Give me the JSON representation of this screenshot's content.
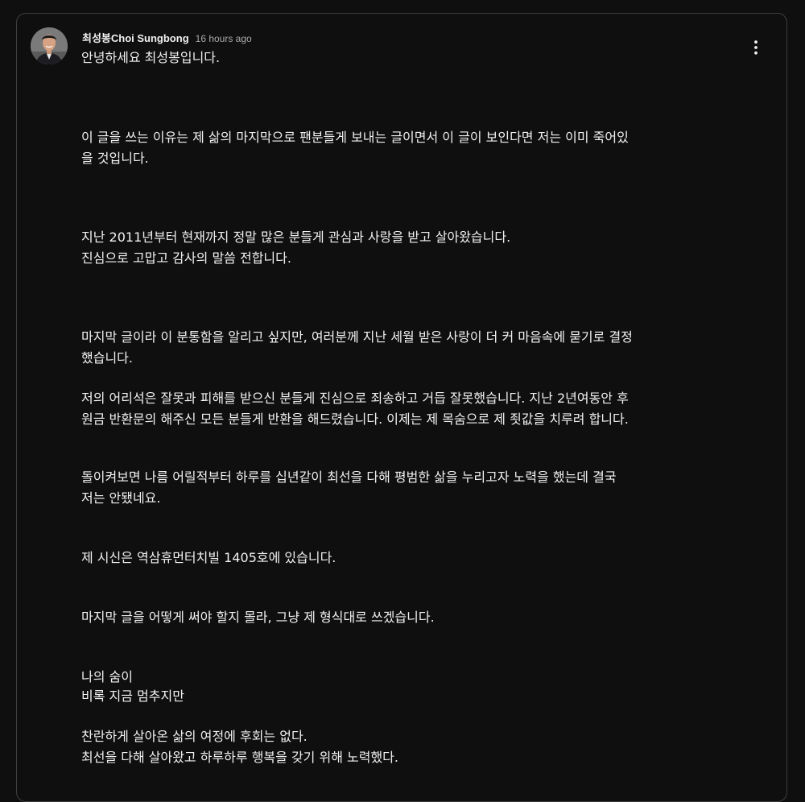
{
  "comment": {
    "author": "최성봉Choi Sungbong",
    "timestamp": "16 hours ago",
    "menu_icon": "more-vert-icon",
    "lines": [
      "안녕하세요 최성봉입니다.",
      "이 글을 쓰는 이유는 제 삶의 마지막으로 팬분들게 보내는 글이면서 이 글이 보인다면 저는 이미 죽어있",
      "을 것입니다.",
      "지난 2011년부터 현재까지 정말 많은 분들게 관심과 사랑을 받고 살아왔습니다.",
      "진심으로 고맙고 감사의 말씀 전합니다.",
      "마지막 글이라 이 분통함을 알리고 싶지만, 여러분께 지난 세월 받은 사랑이 더 커 마음속에 묻기로 결정",
      "했습니다.",
      "저의 어리석은 잘못과 피해를 받으신 분들게 진심으로 죄송하고 거듭 잘못했습니다. 지난 2년여동안 후",
      "원금 반환문의 해주신 모든 분들게 반환을 해드렸습니다. 이제는 제 목숨으로 제 죗값을 치루려 합니다.",
      "돌이켜보면 나름 어릴적부터 하루를 십년같이 최선을 다해 평범한 삶을 누리고자 노력을 했는데 결국",
      "저는 안됐네요.",
      "제 시신은 역삼휴먼터치빌 1405호에 있습니다.",
      "마지막 글을 어떻게 써야 할지 몰라, 그냥 제 형식대로 쓰겠습니다.",
      "나의 숨이",
      "비록 지금 멈추지만",
      "찬란하게 살아온 삶의 여정에 후회는 없다.",
      "최선을 다해 살아왔고 하루하루 행복을 갖기 위해 노력했다."
    ]
  }
}
